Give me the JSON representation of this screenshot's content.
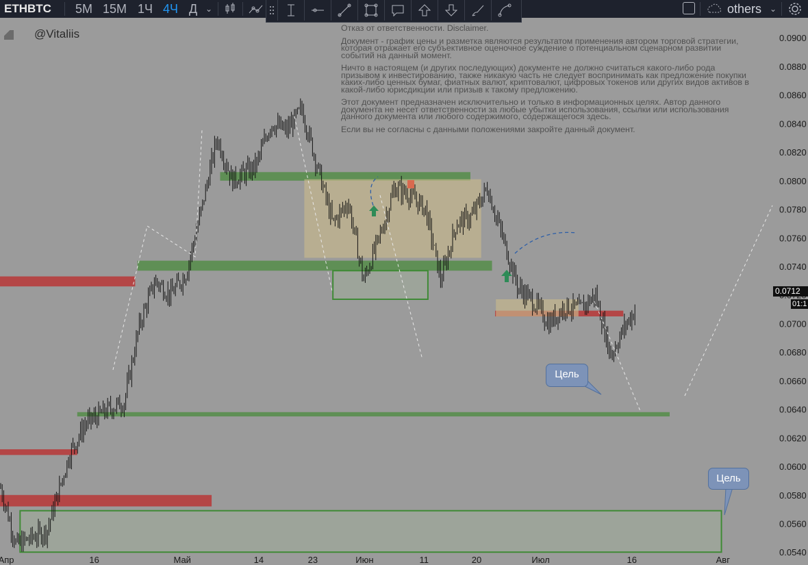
{
  "toolbar": {
    "symbol": "ETHBTC",
    "timeframes": [
      {
        "label": "5M",
        "active": false
      },
      {
        "label": "15M",
        "active": false
      },
      {
        "label": "1Ч",
        "active": false
      },
      {
        "label": "4Ч",
        "active": true
      },
      {
        "label": "Д",
        "active": false
      }
    ],
    "icons": [
      "chevron-down-icon",
      "candles-icon",
      "indicators-icon"
    ],
    "drawing_tools": [
      "drag-handle-icon",
      "text-cursor-icon",
      "horizontal-ray-icon",
      "trend-line-icon",
      "rectangle-icon",
      "comment-icon",
      "arrow-up-icon",
      "arrow-down-icon",
      "brush-icon",
      "curve-icon"
    ],
    "others_label": "others",
    "right_icons": [
      "square-icon",
      "cloud-icon",
      "chevron-down-icon",
      "settings-icon"
    ]
  },
  "author": "@Vitaliis",
  "disclaimer": [
    "Отказ от ответственности. Disclaimer.",
    "Документ - график цены и разметка являются результатом применения автором торговой стратегии, которая отражает его субъективное оценочное суждение о потенциальном сценарном развитии событий на данный момент.",
    "Ничто в настоящем (и других последующих) документе не должно считаться какого-либо рода призывом к инвестированию, также никакую часть не следует воспринимать как предложение покупки каких-либо ценных бумаг, фиатных валют, криптовалют, цифровых токенов или других видов активов в какой-либо юрисдикции или призыв к такому предложению.",
    "Этот документ предназначен исключительно и только в информационных целях. Автор данного документа не несет ответственности за любые убытки использования, ссылки или использования данного документа или любого содержимого, содержащегося здесь.",
    "Если вы не согласны с данными положениями закройте данный документ."
  ],
  "target_labels": [
    "Цель",
    "Цель"
  ],
  "current_price": "0.0712",
  "timer": "01:1",
  "colors": {
    "background": "#9b9b9b",
    "support": "#5f8f55",
    "resistance": "#b44646",
    "box": "#c8b98c",
    "candle": "#111111"
  },
  "chart_data": {
    "type": "candlestick",
    "y_ticks": [
      "0.0900",
      "0.0880",
      "0.0860",
      "0.0840",
      "0.0820",
      "0.0800",
      "0.0780",
      "0.0760",
      "0.0740",
      "0.0720",
      "0.0700",
      "0.0680",
      "0.0660",
      "0.0640",
      "0.0620",
      "0.0600",
      "0.0580",
      "0.0560",
      "0.0540"
    ],
    "y_tick_values": [
      0.09,
      0.088,
      0.086,
      0.084,
      0.082,
      0.08,
      0.078,
      0.076,
      0.074,
      0.072,
      0.07,
      0.068,
      0.066,
      0.064,
      0.062,
      0.06,
      0.058,
      0.056,
      0.054
    ],
    "ylim": [
      0.0531,
      0.0914
    ],
    "x_ticks": [
      "Апр",
      "16",
      "Май",
      "14",
      "23",
      "Июн",
      "11",
      "20",
      "Июл",
      "16",
      "Авг"
    ],
    "price_path": [
      {
        "x": 0.0,
        "y": 0.0585
      },
      {
        "x": 0.02,
        "y": 0.0545
      },
      {
        "x": 0.04,
        "y": 0.055
      },
      {
        "x": 0.06,
        "y": 0.0555
      },
      {
        "x": 0.09,
        "y": 0.061
      },
      {
        "x": 0.11,
        "y": 0.063
      },
      {
        "x": 0.14,
        "y": 0.064
      },
      {
        "x": 0.16,
        "y": 0.0645
      },
      {
        "x": 0.18,
        "y": 0.07
      },
      {
        "x": 0.2,
        "y": 0.073
      },
      {
        "x": 0.22,
        "y": 0.072
      },
      {
        "x": 0.24,
        "y": 0.0735
      },
      {
        "x": 0.26,
        "y": 0.078
      },
      {
        "x": 0.28,
        "y": 0.083
      },
      {
        "x": 0.3,
        "y": 0.08
      },
      {
        "x": 0.33,
        "y": 0.081
      },
      {
        "x": 0.35,
        "y": 0.084
      },
      {
        "x": 0.37,
        "y": 0.0835
      },
      {
        "x": 0.39,
        "y": 0.085
      },
      {
        "x": 0.41,
        "y": 0.081
      },
      {
        "x": 0.43,
        "y": 0.077
      },
      {
        "x": 0.45,
        "y": 0.0785
      },
      {
        "x": 0.47,
        "y": 0.073
      },
      {
        "x": 0.49,
        "y": 0.076
      },
      {
        "x": 0.51,
        "y": 0.0795
      },
      {
        "x": 0.53,
        "y": 0.079
      },
      {
        "x": 0.55,
        "y": 0.078
      },
      {
        "x": 0.57,
        "y": 0.073
      },
      {
        "x": 0.59,
        "y": 0.077
      },
      {
        "x": 0.61,
        "y": 0.0775
      },
      {
        "x": 0.63,
        "y": 0.0795
      },
      {
        "x": 0.65,
        "y": 0.076
      },
      {
        "x": 0.67,
        "y": 0.0725
      },
      {
        "x": 0.69,
        "y": 0.0715
      },
      {
        "x": 0.71,
        "y": 0.07
      },
      {
        "x": 0.73,
        "y": 0.0712
      },
      {
        "x": 0.75,
        "y": 0.071
      },
      {
        "x": 0.77,
        "y": 0.072
      },
      {
        "x": 0.79,
        "y": 0.0678
      },
      {
        "x": 0.81,
        "y": 0.07
      },
      {
        "x": 0.825,
        "y": 0.0712
      }
    ],
    "zones": [
      {
        "kind": "resistance",
        "price_top": 0.0733,
        "price_bottom": 0.0726,
        "start": 0.0,
        "end": 0.175
      },
      {
        "kind": "resistance",
        "price_top": 0.0612,
        "price_bottom": 0.0608,
        "start": 0.0,
        "end": 0.1
      },
      {
        "kind": "resistance",
        "price_top": 0.058,
        "price_bottom": 0.0572,
        "start": 0.0,
        "end": 0.274
      },
      {
        "kind": "resistance",
        "price_top": 0.0709,
        "price_bottom": 0.0705,
        "start": 0.641,
        "end": 0.807
      },
      {
        "kind": "support",
        "price_top": 0.0806,
        "price_bottom": 0.08,
        "start": 0.285,
        "end": 0.609
      },
      {
        "kind": "support",
        "price_top": 0.0744,
        "price_bottom": 0.0737,
        "start": 0.178,
        "end": 0.637
      },
      {
        "kind": "support",
        "price_top": 0.0638,
        "price_bottom": 0.0635,
        "start": 0.1,
        "end": 0.867
      },
      {
        "kind": "box",
        "price_top": 0.0801,
        "price_bottom": 0.0746,
        "start": 0.394,
        "end": 0.623
      },
      {
        "kind": "box",
        "price_top": 0.0717,
        "price_bottom": 0.0705,
        "start": 0.642,
        "end": 0.749
      },
      {
        "kind": "support-box",
        "price_top": 0.0737,
        "price_bottom": 0.0717,
        "start": 0.431,
        "end": 0.554
      },
      {
        "kind": "support-box",
        "price_top": 0.0569,
        "price_bottom": 0.054,
        "start": 0.026,
        "end": 0.934
      }
    ]
  }
}
